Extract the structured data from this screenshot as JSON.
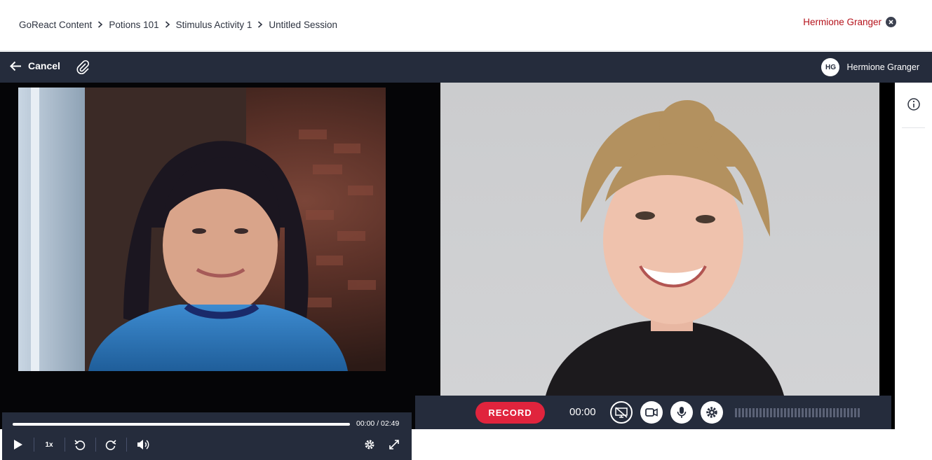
{
  "breadcrumb": {
    "items": [
      "GoReact Content",
      "Potions 101",
      "Stimulus Activity 1",
      "Untitled Session"
    ]
  },
  "top_user": {
    "name": "Hermione Granger",
    "close_icon": "close-circle-icon"
  },
  "appbar": {
    "cancel_label": "Cancel",
    "attach_icon": "paperclip-icon",
    "user_initials": "HG",
    "user_name": "Hermione Granger"
  },
  "player": {
    "timecode": "00:00 / 02:49",
    "speed": "1x",
    "progress_fraction": 0.0,
    "icons": [
      "play-icon",
      "rewind-icon",
      "forward-icon",
      "volume-icon",
      "settings-icon",
      "fullscreen-icon"
    ]
  },
  "recorder": {
    "record_label": "RECORD",
    "elapsed": "00:00",
    "icons": [
      "screen-share-off-icon",
      "camera-icon",
      "microphone-icon",
      "settings-icon"
    ]
  },
  "side_panel": {
    "icon": "info-icon"
  },
  "colors": {
    "brand_dark": "#252c3c",
    "record_red": "#e0243d",
    "user_link_red": "#b5121b",
    "progress_red": "#e61a3a"
  }
}
